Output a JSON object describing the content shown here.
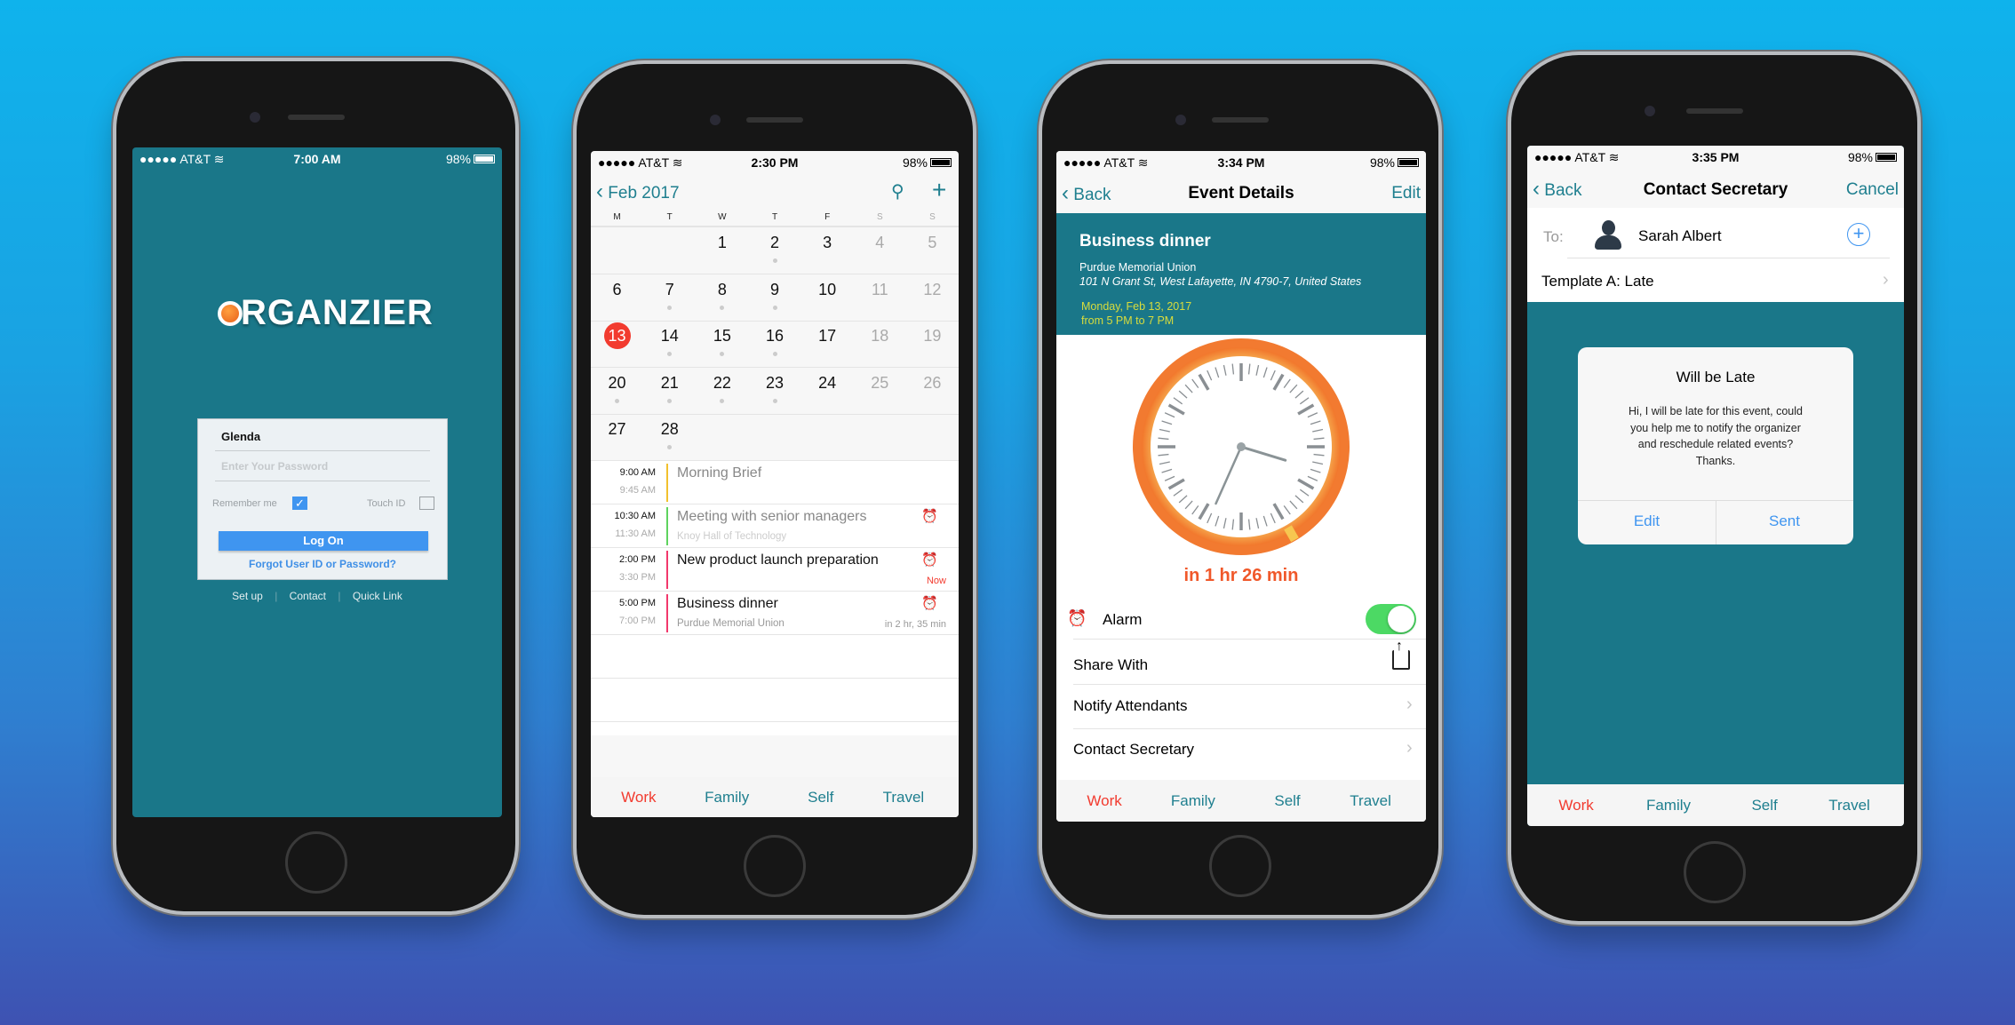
{
  "status": {
    "carrier": "AT&T",
    "battery": "98%"
  },
  "tabs": [
    {
      "label": "Work",
      "color": "#f23b2f"
    },
    {
      "label": "Family",
      "color": "#1f7f8f"
    },
    {
      "label": "Self",
      "color": "#1f7f8f"
    },
    {
      "label": "Travel",
      "color": "#1f7f8f"
    }
  ],
  "login": {
    "time": "7:00 AM",
    "logo": "ORGANZIER",
    "username": "Glenda",
    "password_placeholder": "Enter Your Password",
    "remember_label": "Remember me",
    "remember_checked": true,
    "touch_id_label": "Touch ID",
    "touch_id_checked": false,
    "logon_label": "Log On",
    "forgot_label": "Forgot User ID or Password?",
    "footer_links": [
      "Set up",
      "Contact",
      "Quick Link"
    ]
  },
  "calendar": {
    "time": "2:30 PM",
    "month": "Feb 2017",
    "weekdays": [
      "M",
      "T",
      "W",
      "T",
      "F",
      "S",
      "S"
    ],
    "first_weekday_index": 2,
    "days_in_month": 28,
    "today": 13,
    "days_with_events": [
      2,
      7,
      8,
      9,
      14,
      15,
      16,
      20,
      21,
      22,
      23,
      28
    ],
    "events": [
      {
        "start": "9:00 AM",
        "end": "9:45 AM",
        "title": "Morning Brief",
        "subtitle": "",
        "bar_color": "#f2c12e",
        "muted": true,
        "alarm": false,
        "note": ""
      },
      {
        "start": "10:30 AM",
        "end": "11:30 AM",
        "title": "Meeting with senior managers",
        "subtitle": "Knoy Hall of Technology",
        "bar_color": "#5ed35e",
        "muted": true,
        "alarm": true,
        "note": ""
      },
      {
        "start": "2:00 PM",
        "end": "3:30 PM",
        "title": "New product launch preparation",
        "subtitle": "",
        "bar_color": "#f2386c",
        "muted": false,
        "alarm": true,
        "note": "Now"
      },
      {
        "start": "5:00 PM",
        "end": "7:00 PM",
        "title": "Business dinner",
        "subtitle": "Purdue Memorial Union",
        "bar_color": "#f2386c",
        "muted": false,
        "alarm": true,
        "note": "in 2 hr, 35 min"
      }
    ]
  },
  "event_details": {
    "time": "3:34 PM",
    "back_label": "Back",
    "title": "Event Details",
    "edit_label": "Edit",
    "event_title": "Business dinner",
    "venue": "Purdue Memorial Union",
    "address": "101 N Grant St, West Lafayette, IN 4790-7, United States",
    "date": "Monday, Feb 13, 2017",
    "time_range": "from 5 PM to 7 PM",
    "countdown": "in 1 hr 26 min",
    "clock": {
      "hour": 3,
      "minute": 34
    },
    "alarm_label": "Alarm",
    "alarm_on": true,
    "share_label": "Share With",
    "notify_label": "Notify Attendants",
    "contact_label": "Contact Secretary"
  },
  "contact": {
    "time": "3:35 PM",
    "back_label": "Back",
    "title": "Contact Secretary",
    "cancel_label": "Cancel",
    "to_label": "To:",
    "recipient": "Sarah Albert",
    "template": "Template A: Late",
    "dialog": {
      "title": "Will be Late",
      "message_lines": [
        "Hi, I will be late for this event, could",
        "you help me to notify the organizer",
        "and reschedule related events?",
        "Thanks."
      ],
      "edit_label": "Edit",
      "send_label": "Sent"
    }
  },
  "colors": {
    "teal": "#1a7789",
    "accent_red": "#f23b2f",
    "link_blue": "#3f95f0",
    "toggle_green": "#4cd964"
  }
}
